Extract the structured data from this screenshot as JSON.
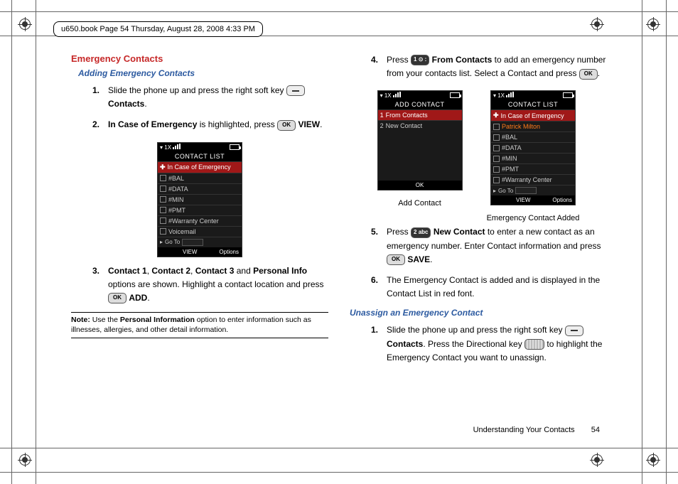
{
  "header_stamp": "u650.book  Page 54  Thursday, August 28, 2008  4:33 PM",
  "left": {
    "h1": "Emergency Contacts",
    "h2": "Adding Emergency Contacts",
    "steps": {
      "s1": {
        "num": "1.",
        "a": "Slide the phone up and press the right soft key ",
        "b": " Contacts",
        "c": "."
      },
      "s2": {
        "num": "2.",
        "a": "In Case of Emergency",
        "b": " is highlighted, press ",
        "c": " VIEW",
        "d": "."
      },
      "s3": {
        "num": "3.",
        "a": "Contact 1",
        "b": "Contact 2",
        "c": "Contact 3",
        "d": "Personal Info",
        "e": " options are shown. Highlight a contact location and press ",
        "f": " ADD",
        "g": "."
      }
    },
    "note_label": "Note:",
    "note_body": " Use the Personal Information option to enter information such as illnesses, allergies, and other detail information.",
    "note_bold": "Personal Information",
    "note_pre": " Use the ",
    "note_post": " option to enter information such as illnesses, allergies, and other detail information."
  },
  "right": {
    "steps": {
      "s4": {
        "num": "4.",
        "a": "Press ",
        "b": " From Contacts",
        "c": " to add an emergency number from your contacts list. Select a Contact and press ",
        "d": "."
      },
      "s5": {
        "num": "5.",
        "a": "Press ",
        "b": " New Contact",
        "c": " to enter a new contact as an emergency number. Enter Contact information and press ",
        "d": " SAVE",
        "e": "."
      },
      "s6": {
        "num": "6.",
        "a": "The Emergency Contact is added and is displayed in the Contact List in red font."
      }
    },
    "h2": "Unassign an Emergency Contact",
    "steps2": {
      "s1": {
        "num": "1.",
        "a": "Slide the phone up and press the right soft key ",
        "b": " Contacts",
        "c": ". Press the Directional key ",
        "d": " to highlight the Emergency Contact you want to unassign."
      }
    },
    "caption_left": "Add Contact",
    "caption_right": "Emergency Contact Added"
  },
  "phone_contact_list": {
    "title": "CONTACT LIST",
    "items": [
      "In Case of Emergency",
      "#BAL",
      "#DATA",
      "#MIN",
      "#PMT",
      "#Warranty Center",
      "Voicemail"
    ],
    "goto": "Go To",
    "soft_left": "VIEW",
    "soft_right": "Options",
    "signal": "1X"
  },
  "phone_add_contact": {
    "title": "ADD CONTACT",
    "items": [
      "From Contacts",
      "New Contact"
    ],
    "item_nums": [
      "1",
      "2"
    ],
    "soft_center": "OK",
    "signal": "1X"
  },
  "phone_emergency_added": {
    "title": "CONTACT LIST",
    "items": [
      "In Case of Emergency",
      "Patrick Milton",
      "#BAL",
      "#DATA",
      "#MIN",
      "#PMT",
      "#Warranty Center"
    ],
    "goto": "Go To",
    "soft_left": "VIEW",
    "soft_right": "Options",
    "signal": "1X"
  },
  "keys": {
    "ok": "OK",
    "one": "1 ⊙ :",
    "two": "2 abc"
  },
  "footer": {
    "chapter": "Understanding Your Contacts",
    "page": "54"
  }
}
